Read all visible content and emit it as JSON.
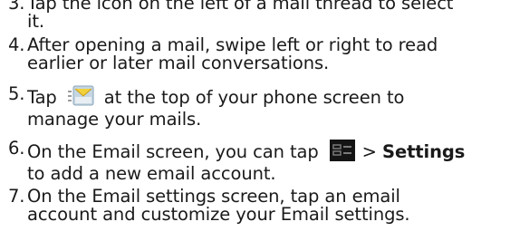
{
  "steps": [
    {
      "number": "3.",
      "lines": [
        "Tap the icon on the left of a mail thread to select",
        "it."
      ]
    },
    {
      "number": "4.",
      "lines": [
        "After opening a mail, swipe left or right to read",
        "earlier or later mail conversations."
      ]
    },
    {
      "number": "5.",
      "before_icon": "Tap",
      "icon": "mail-folder-icon",
      "after_icon": "at the top of your phone screen to",
      "line2": "manage your mails."
    },
    {
      "number": "6.",
      "before_icon": "On the Email screen, you can tap",
      "icon": "menu-icon",
      "after_icon": ">",
      "bold_text": "Settings",
      "line2": "to add a new email account."
    },
    {
      "number": "7.",
      "lines": [
        "On the Email settings screen, tap an email",
        "account and customize your Email settings."
      ]
    }
  ]
}
